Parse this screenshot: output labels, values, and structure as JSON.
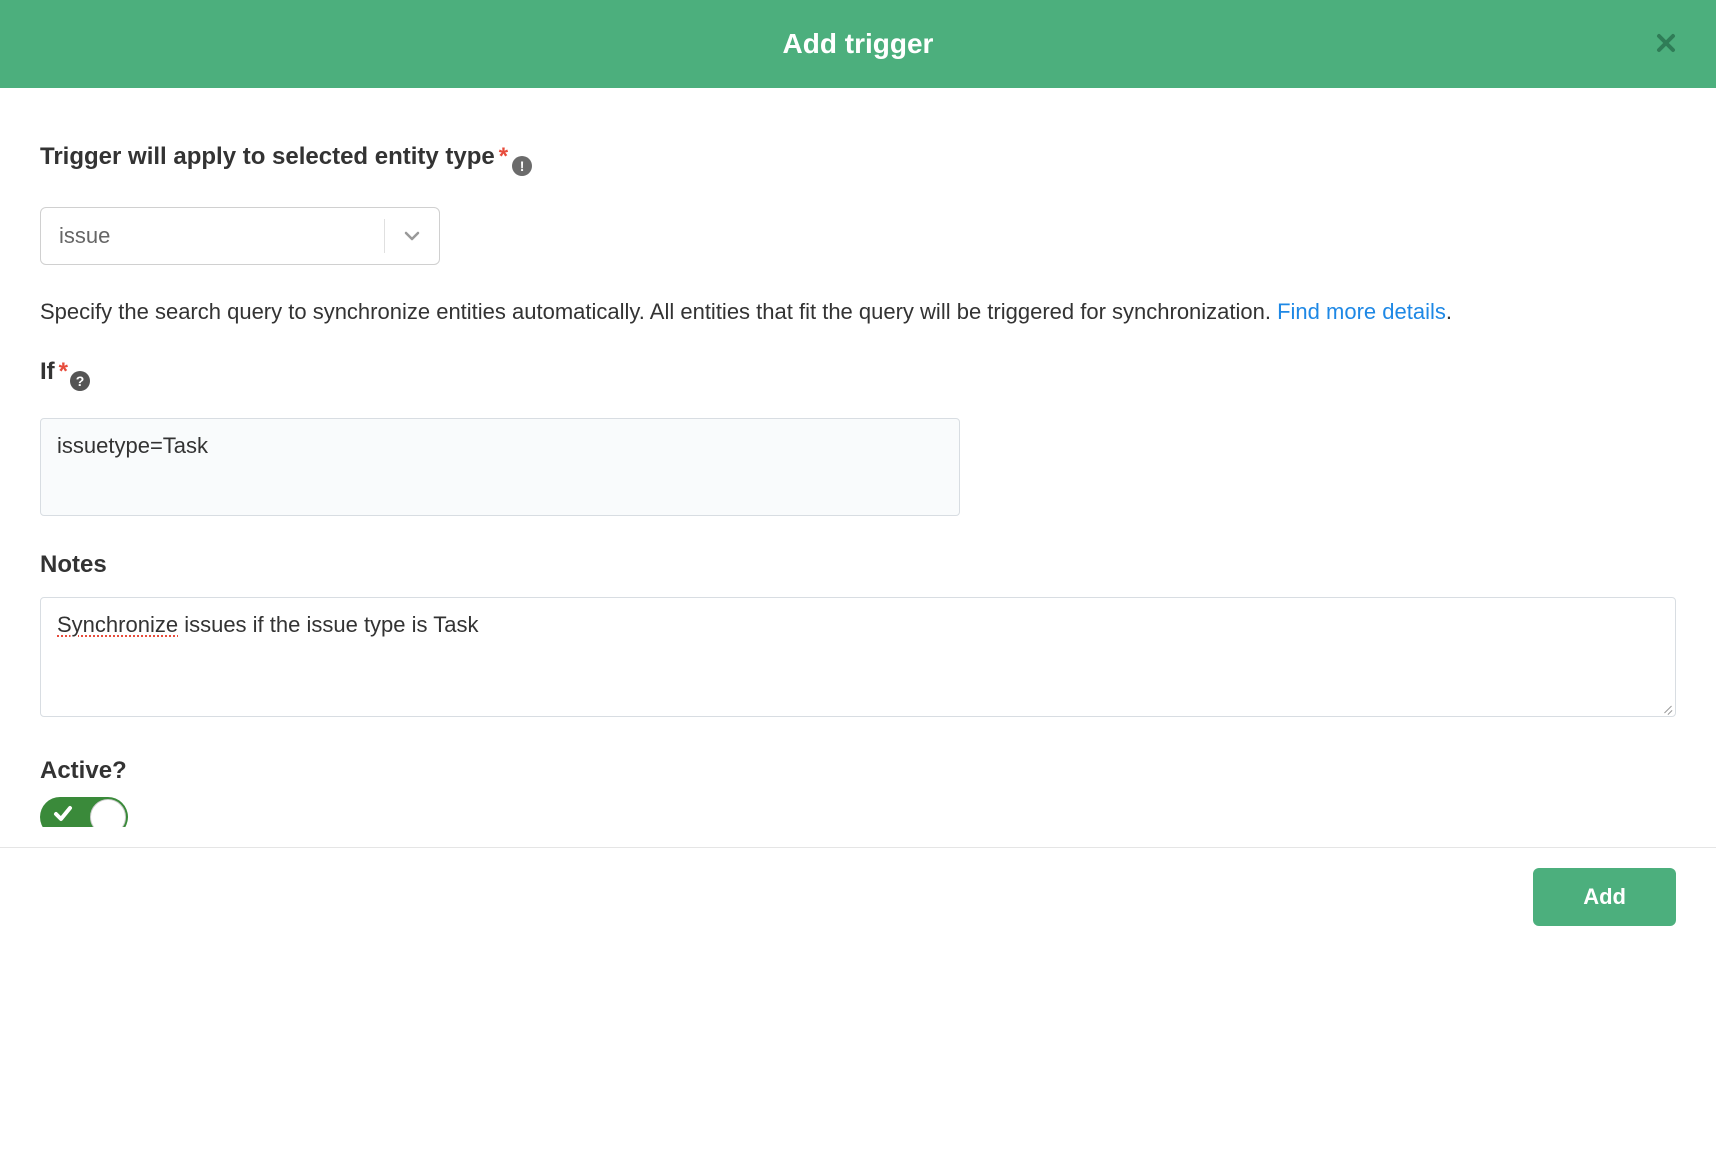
{
  "header": {
    "title": "Add trigger"
  },
  "entityType": {
    "label": "Trigger will apply to selected entity type",
    "value": "issue"
  },
  "description": {
    "text": "Specify the search query to synchronize entities automatically. All entities that fit the query will be triggered for synchronization. ",
    "linkText": "Find more details",
    "period": "."
  },
  "ifSection": {
    "label": "If",
    "value": "issuetype=Task"
  },
  "notes": {
    "label": "Notes",
    "valueWord": "Synchronize",
    "valueRest": " issues if the issue type is Task"
  },
  "active": {
    "label": "Active?"
  },
  "footer": {
    "addLabel": "Add"
  }
}
